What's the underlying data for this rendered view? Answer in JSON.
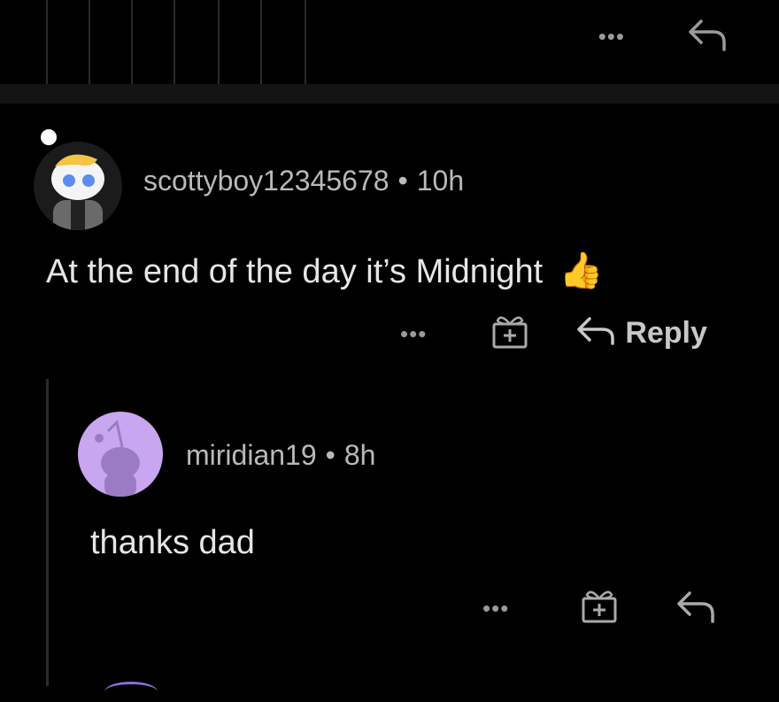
{
  "top_bar": {
    "more_label": "•••"
  },
  "comments": [
    {
      "username": "scottyboy12345678",
      "separator": "•",
      "age": "10h",
      "text": "At the end of the day it’s Midnight",
      "emoji": "👍",
      "actions": {
        "more_label": "•••",
        "reply_label": "Reply"
      }
    },
    {
      "username": "miridian19",
      "separator": "•",
      "age": "8h",
      "text": "thanks dad",
      "actions": {
        "more_label": "•••"
      }
    }
  ],
  "colors": {
    "background": "#000000",
    "divider": "#141414",
    "muted_text": "#b9b9b9",
    "body_text": "#e6e6e6",
    "avatar2_bg": "#c9a7f0"
  }
}
